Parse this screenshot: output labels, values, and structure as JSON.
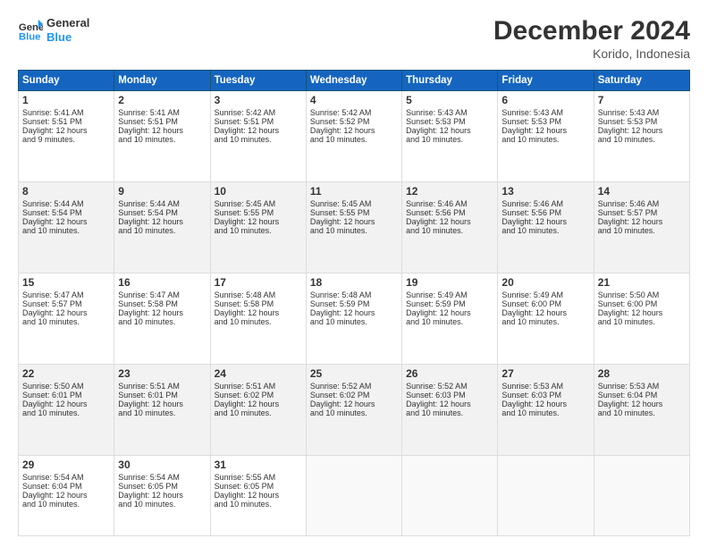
{
  "header": {
    "logo_line1": "General",
    "logo_line2": "Blue",
    "title": "December 2024",
    "subtitle": "Korido, Indonesia"
  },
  "days_of_week": [
    "Sunday",
    "Monday",
    "Tuesday",
    "Wednesday",
    "Thursday",
    "Friday",
    "Saturday"
  ],
  "weeks": [
    [
      {
        "day": "1",
        "lines": [
          "Sunrise: 5:41 AM",
          "Sunset: 5:51 PM",
          "Daylight: 12 hours",
          "and 9 minutes."
        ]
      },
      {
        "day": "2",
        "lines": [
          "Sunrise: 5:41 AM",
          "Sunset: 5:51 PM",
          "Daylight: 12 hours",
          "and 10 minutes."
        ]
      },
      {
        "day": "3",
        "lines": [
          "Sunrise: 5:42 AM",
          "Sunset: 5:51 PM",
          "Daylight: 12 hours",
          "and 10 minutes."
        ]
      },
      {
        "day": "4",
        "lines": [
          "Sunrise: 5:42 AM",
          "Sunset: 5:52 PM",
          "Daylight: 12 hours",
          "and 10 minutes."
        ]
      },
      {
        "day": "5",
        "lines": [
          "Sunrise: 5:43 AM",
          "Sunset: 5:53 PM",
          "Daylight: 12 hours",
          "and 10 minutes."
        ]
      },
      {
        "day": "6",
        "lines": [
          "Sunrise: 5:43 AM",
          "Sunset: 5:53 PM",
          "Daylight: 12 hours",
          "and 10 minutes."
        ]
      },
      {
        "day": "7",
        "lines": [
          "Sunrise: 5:43 AM",
          "Sunset: 5:53 PM",
          "Daylight: 12 hours",
          "and 10 minutes."
        ]
      }
    ],
    [
      {
        "day": "8",
        "lines": [
          "Sunrise: 5:44 AM",
          "Sunset: 5:54 PM",
          "Daylight: 12 hours",
          "and 10 minutes."
        ]
      },
      {
        "day": "9",
        "lines": [
          "Sunrise: 5:44 AM",
          "Sunset: 5:54 PM",
          "Daylight: 12 hours",
          "and 10 minutes."
        ]
      },
      {
        "day": "10",
        "lines": [
          "Sunrise: 5:45 AM",
          "Sunset: 5:55 PM",
          "Daylight: 12 hours",
          "and 10 minutes."
        ]
      },
      {
        "day": "11",
        "lines": [
          "Sunrise: 5:45 AM",
          "Sunset: 5:55 PM",
          "Daylight: 12 hours",
          "and 10 minutes."
        ]
      },
      {
        "day": "12",
        "lines": [
          "Sunrise: 5:46 AM",
          "Sunset: 5:56 PM",
          "Daylight: 12 hours",
          "and 10 minutes."
        ]
      },
      {
        "day": "13",
        "lines": [
          "Sunrise: 5:46 AM",
          "Sunset: 5:56 PM",
          "Daylight: 12 hours",
          "and 10 minutes."
        ]
      },
      {
        "day": "14",
        "lines": [
          "Sunrise: 5:46 AM",
          "Sunset: 5:57 PM",
          "Daylight: 12 hours",
          "and 10 minutes."
        ]
      }
    ],
    [
      {
        "day": "15",
        "lines": [
          "Sunrise: 5:47 AM",
          "Sunset: 5:57 PM",
          "Daylight: 12 hours",
          "and 10 minutes."
        ]
      },
      {
        "day": "16",
        "lines": [
          "Sunrise: 5:47 AM",
          "Sunset: 5:58 PM",
          "Daylight: 12 hours",
          "and 10 minutes."
        ]
      },
      {
        "day": "17",
        "lines": [
          "Sunrise: 5:48 AM",
          "Sunset: 5:58 PM",
          "Daylight: 12 hours",
          "and 10 minutes."
        ]
      },
      {
        "day": "18",
        "lines": [
          "Sunrise: 5:48 AM",
          "Sunset: 5:59 PM",
          "Daylight: 12 hours",
          "and 10 minutes."
        ]
      },
      {
        "day": "19",
        "lines": [
          "Sunrise: 5:49 AM",
          "Sunset: 5:59 PM",
          "Daylight: 12 hours",
          "and 10 minutes."
        ]
      },
      {
        "day": "20",
        "lines": [
          "Sunrise: 5:49 AM",
          "Sunset: 6:00 PM",
          "Daylight: 12 hours",
          "and 10 minutes."
        ]
      },
      {
        "day": "21",
        "lines": [
          "Sunrise: 5:50 AM",
          "Sunset: 6:00 PM",
          "Daylight: 12 hours",
          "and 10 minutes."
        ]
      }
    ],
    [
      {
        "day": "22",
        "lines": [
          "Sunrise: 5:50 AM",
          "Sunset: 6:01 PM",
          "Daylight: 12 hours",
          "and 10 minutes."
        ]
      },
      {
        "day": "23",
        "lines": [
          "Sunrise: 5:51 AM",
          "Sunset: 6:01 PM",
          "Daylight: 12 hours",
          "and 10 minutes."
        ]
      },
      {
        "day": "24",
        "lines": [
          "Sunrise: 5:51 AM",
          "Sunset: 6:02 PM",
          "Daylight: 12 hours",
          "and 10 minutes."
        ]
      },
      {
        "day": "25",
        "lines": [
          "Sunrise: 5:52 AM",
          "Sunset: 6:02 PM",
          "Daylight: 12 hours",
          "and 10 minutes."
        ]
      },
      {
        "day": "26",
        "lines": [
          "Sunrise: 5:52 AM",
          "Sunset: 6:03 PM",
          "Daylight: 12 hours",
          "and 10 minutes."
        ]
      },
      {
        "day": "27",
        "lines": [
          "Sunrise: 5:53 AM",
          "Sunset: 6:03 PM",
          "Daylight: 12 hours",
          "and 10 minutes."
        ]
      },
      {
        "day": "28",
        "lines": [
          "Sunrise: 5:53 AM",
          "Sunset: 6:04 PM",
          "Daylight: 12 hours",
          "and 10 minutes."
        ]
      }
    ],
    [
      {
        "day": "29",
        "lines": [
          "Sunrise: 5:54 AM",
          "Sunset: 6:04 PM",
          "Daylight: 12 hours",
          "and 10 minutes."
        ]
      },
      {
        "day": "30",
        "lines": [
          "Sunrise: 5:54 AM",
          "Sunset: 6:05 PM",
          "Daylight: 12 hours",
          "and 10 minutes."
        ]
      },
      {
        "day": "31",
        "lines": [
          "Sunrise: 5:55 AM",
          "Sunset: 6:05 PM",
          "Daylight: 12 hours",
          "and 10 minutes."
        ]
      },
      null,
      null,
      null,
      null
    ]
  ]
}
